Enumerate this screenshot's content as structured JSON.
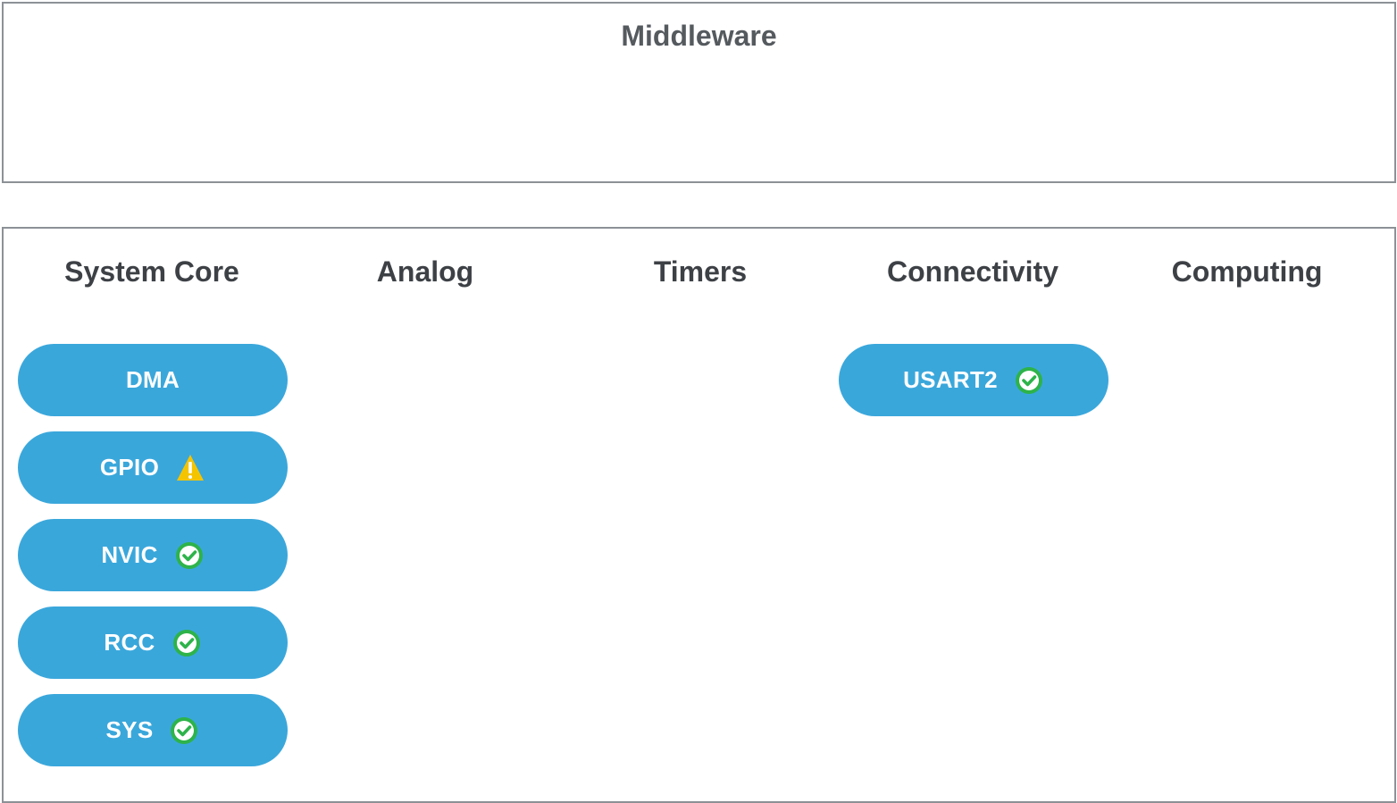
{
  "middleware": {
    "title": "Middleware"
  },
  "categories": [
    "System Core",
    "Analog",
    "Timers",
    "Connectivity",
    "Computing"
  ],
  "system_core_items": [
    {
      "label": "DMA",
      "status": "none"
    },
    {
      "label": "GPIO",
      "status": "warning"
    },
    {
      "label": "NVIC",
      "status": "ok"
    },
    {
      "label": "RCC",
      "status": "ok"
    },
    {
      "label": "SYS",
      "status": "ok"
    }
  ],
  "connectivity_items": [
    {
      "label": "USART2",
      "status": "ok"
    }
  ],
  "icons": {
    "ok": "check-circle-icon",
    "warning": "warning-triangle-icon"
  },
  "colors": {
    "pill": "#3aa7db",
    "ok": "#2db34a",
    "warning": "#f5c400",
    "border": "#8c9196"
  }
}
